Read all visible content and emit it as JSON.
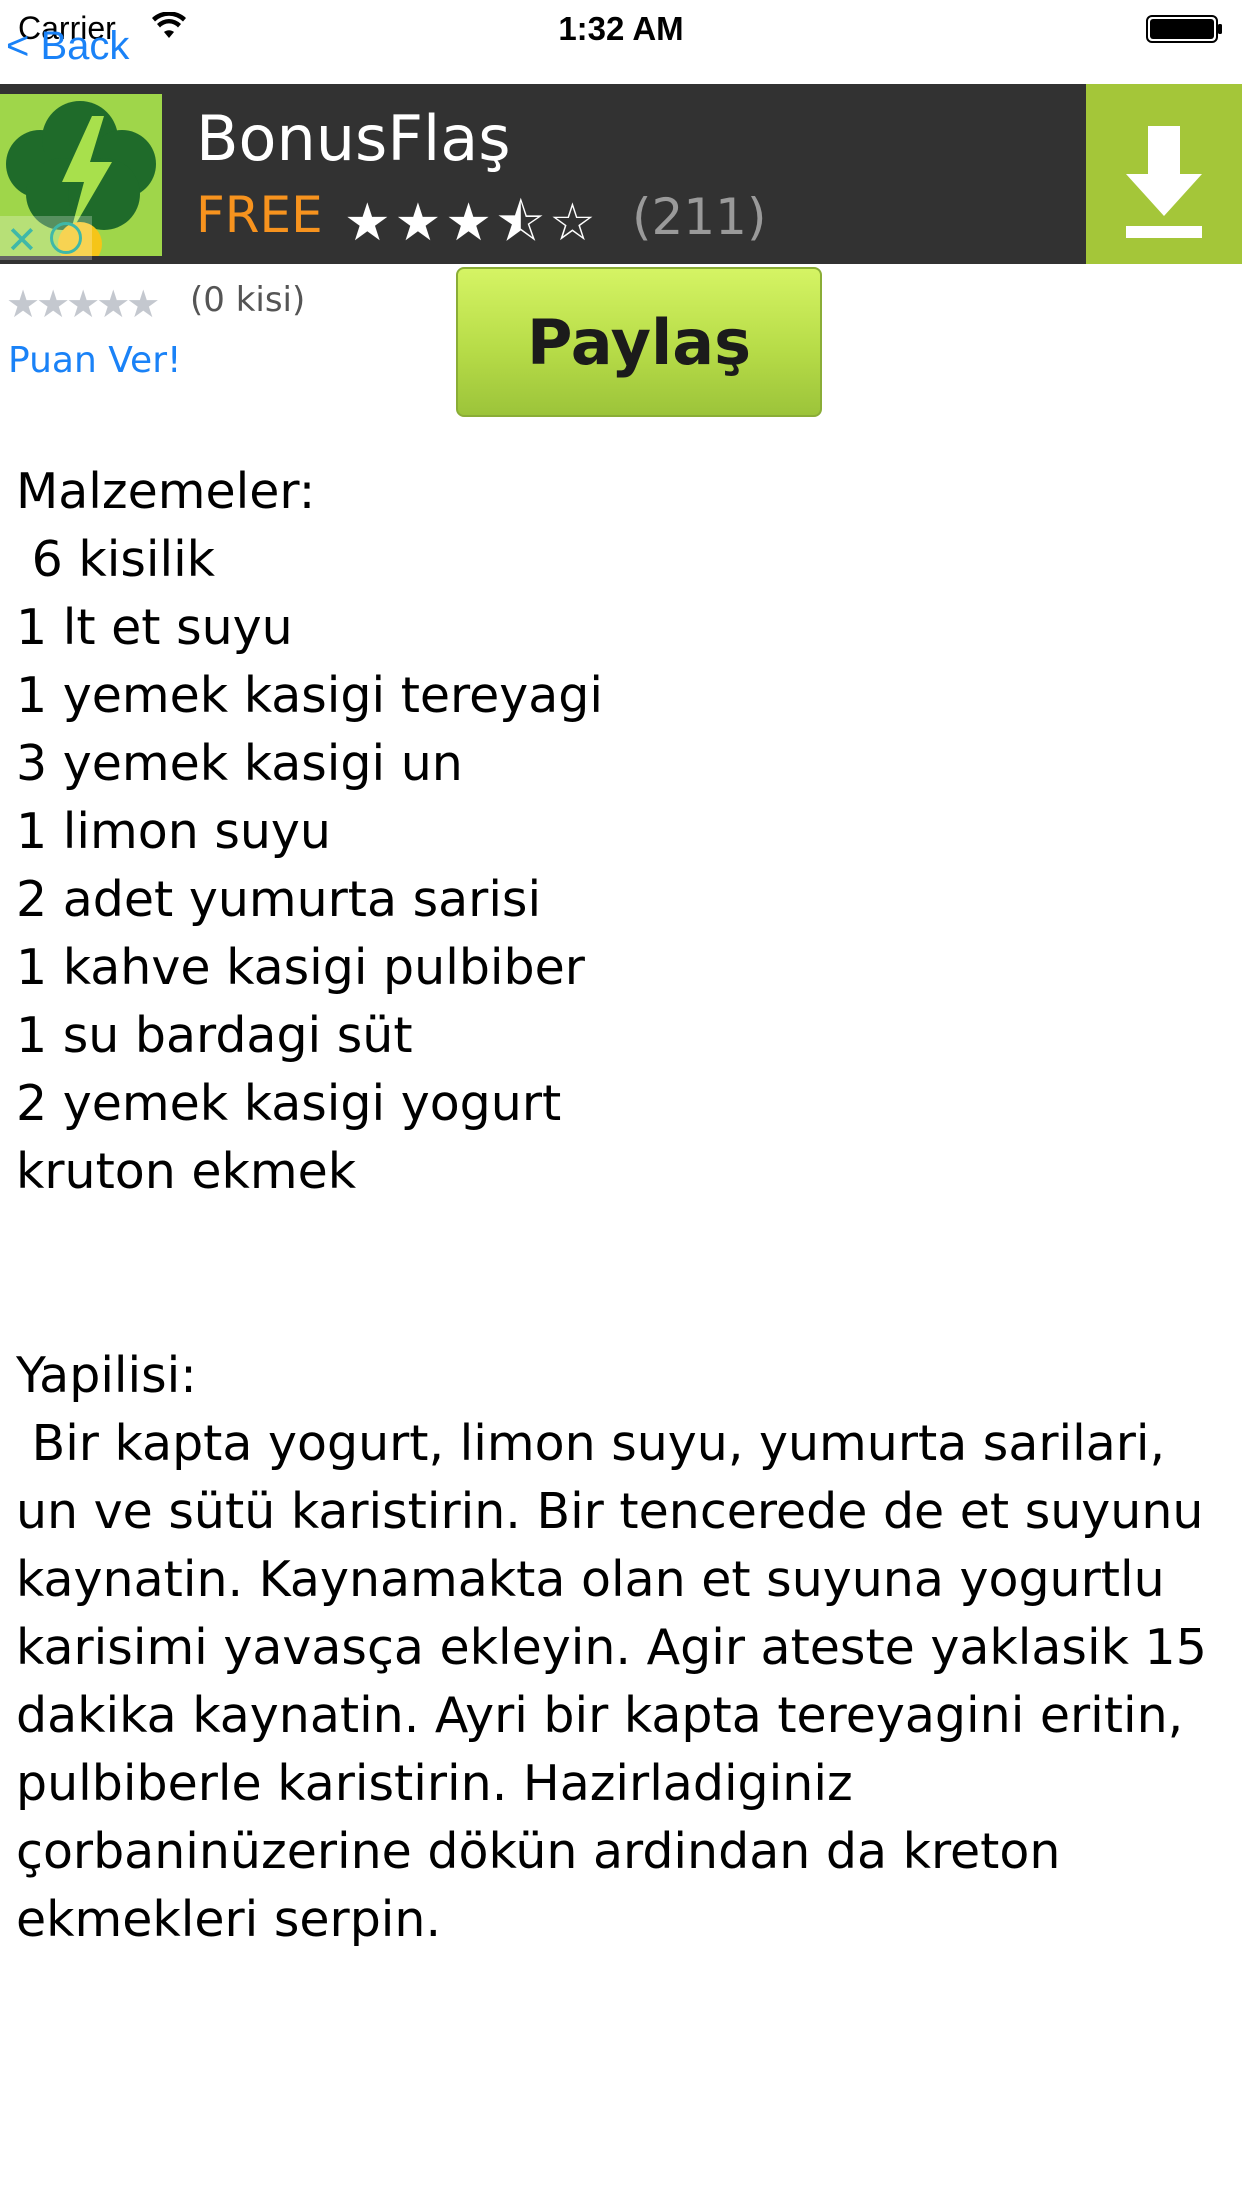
{
  "status_bar": {
    "carrier": "Carrier",
    "time": "1:32 AM",
    "wifi_icon": "wifi-icon",
    "battery_icon": "battery-icon"
  },
  "nav": {
    "back_label": "< Back"
  },
  "ad": {
    "app_name": "BonusFlaş",
    "price": "FREE",
    "stars": "★★★⯪☆",
    "rating_fraction": 0.7,
    "review_count": "(211)",
    "download_icon": "download-icon",
    "close_icon": "close-icon",
    "info_icon": "info-icon",
    "colors": {
      "background": "#323232",
      "price": "#f7931e",
      "download_bg": "#a4c639"
    }
  },
  "rating": {
    "stars": "★★★★★",
    "value": 0,
    "count_label": "(0 kisi)",
    "rate_label": "Puan Ver!"
  },
  "share": {
    "label": "Paylaş"
  },
  "recipe": {
    "ingredients_title": "Malzemeler:",
    "ingredients": [
      " 6 kisilik",
      "1 lt et suyu",
      "1 yemek kasigi tereyagi",
      "3 yemek kasigi un",
      "1 limon suyu",
      "2 adet yumurta sarisi",
      "1 kahve kasigi pulbiber",
      "1 su bardagi süt",
      "2 yemek kasigi yogurt",
      "kruton ekmek"
    ],
    "method_title": "Yapilisi:",
    "method_text": " Bir kapta yogurt, limon suyu, yumurta sarilari, un ve sütü karistirin. Bir tencerede de et suyunu kaynatin. Kaynamakta olan et suyuna yogurtlu karisimi yavasça ekleyin. Agir ateste yaklasik 15 dakika kaynatin. Ayri bir kapta tereyagini eritin, pulbiberle karistirin. Hazirladiginiz çorbaninüzerine dökün ardindan da kreton ekmekleri serpin."
  }
}
